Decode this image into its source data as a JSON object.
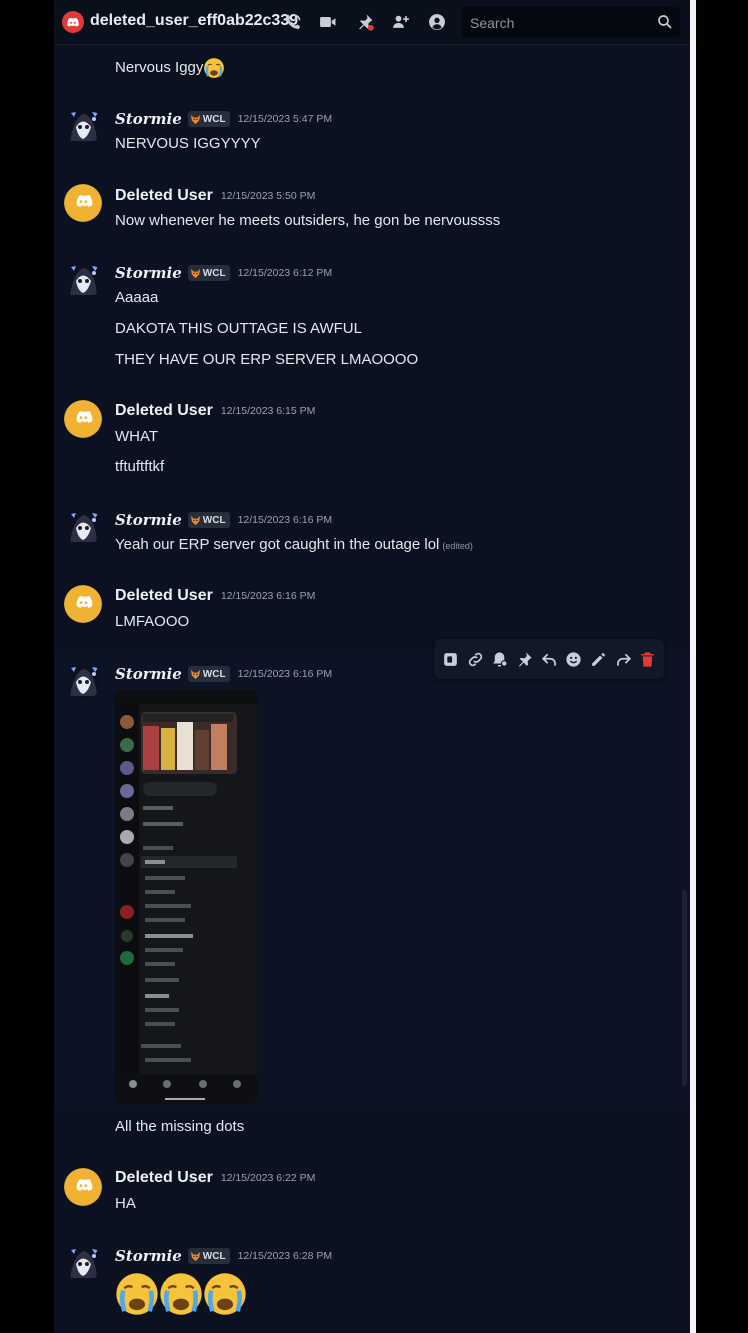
{
  "header": {
    "channel_name": "deleted_user_eff0ab22c339",
    "search_placeholder": "Search",
    "icons": [
      "phone-call-icon",
      "video-call-icon",
      "pinned-messages-icon",
      "add-friends-icon",
      "user-profile-icon",
      "search-icon"
    ]
  },
  "messages": [
    {
      "continuation": true,
      "lines": [
        "Nervous Iggy"
      ],
      "emoji": "crying-face"
    },
    {
      "author": "Stormie",
      "tag": "WCL",
      "timestamp": "12/15/2023 5:47 PM",
      "lines": [
        "NERVOUS IGGYYYY"
      ]
    },
    {
      "author": "Deleted User",
      "timestamp": "12/15/2023 5:50 PM",
      "lines": [
        "Now whenever he meets outsiders, he gon be nervoussss"
      ]
    },
    {
      "author": "Stormie",
      "tag": "WCL",
      "timestamp": "12/15/2023 6:12 PM",
      "lines": [
        "Aaaaa",
        "DAKOTA THIS OUTTAGE IS AWFUL",
        "THEY HAVE OUR ERP SERVER LMAOOOO"
      ]
    },
    {
      "author": "Deleted User",
      "timestamp": "12/15/2023 6:15 PM",
      "lines": [
        "WHAT",
        "tftuftftkf"
      ]
    },
    {
      "author": "Stormie",
      "tag": "WCL",
      "timestamp": "12/15/2023 6:16 PM",
      "lines": [
        "Yeah our ERP server got caught in the outage lol"
      ],
      "edited_label": "(edited)"
    },
    {
      "author": "Deleted User",
      "timestamp": "12/15/2023 6:16 PM",
      "lines": [
        "LMFAOOO"
      ]
    },
    {
      "author": "Stormie",
      "tag": "WCL",
      "timestamp": "12/15/2023 6:16 PM",
      "attachment": "phone-screenshot",
      "lines": [
        "All the missing dots"
      ]
    },
    {
      "author": "Deleted User",
      "timestamp": "12/15/2023 6:22 PM",
      "lines": [
        "HA"
      ]
    },
    {
      "author": "Stormie",
      "tag": "WCL",
      "timestamp": "12/15/2023 6:28 PM",
      "emojis": [
        "crying-face",
        "crying-face",
        "crying-face"
      ]
    }
  ],
  "toolbar_icons": [
    "app-icon",
    "copy-link-icon",
    "mark-unread-icon",
    "pin-icon",
    "reply-icon",
    "add-reaction-icon",
    "edit-icon",
    "forward-icon",
    "delete-icon"
  ],
  "colors": {
    "background": "#0b1120",
    "delete": "#e23a3a",
    "deleted_user_avatar": "#f0b232"
  }
}
